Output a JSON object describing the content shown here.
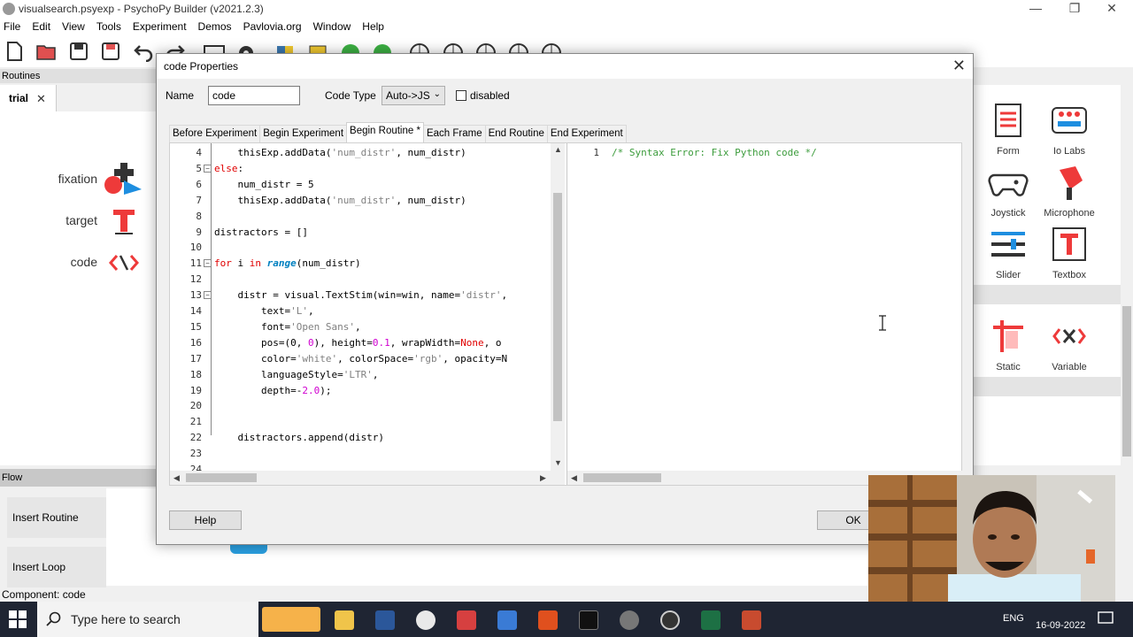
{
  "window": {
    "title": "visualsearch.psyexp - PsychoPy Builder (v2021.2.3)",
    "menu": [
      "File",
      "Edit",
      "View",
      "Tools",
      "Experiment",
      "Demos",
      "Pavlovia.org",
      "Window",
      "Help"
    ]
  },
  "routines": {
    "header": "Routines",
    "active_tab": "trial",
    "components": [
      "fixation",
      "target",
      "code"
    ]
  },
  "flow": {
    "header": "Flow",
    "insert_routine": "Insert Routine",
    "insert_loop": "Insert Loop"
  },
  "status_bar": "Component: code",
  "components_panel": {
    "items": [
      {
        "label": "Form",
        "icon": "form-icon"
      },
      {
        "label": "Io Labs",
        "icon": "iolabs-icon"
      },
      {
        "label": "Joystick",
        "icon": "joystick-icon"
      },
      {
        "label": "Microphone",
        "icon": "microphone-icon"
      },
      {
        "label": "Slider",
        "icon": "slider-icon"
      },
      {
        "label": "Textbox",
        "icon": "textbox-icon"
      },
      {
        "label": "Static",
        "icon": "static-icon"
      },
      {
        "label": "Variable",
        "icon": "variable-icon"
      }
    ]
  },
  "dialog": {
    "title": "code Properties",
    "name_label": "Name",
    "name_value": "code",
    "code_type_label": "Code Type",
    "code_type_value": "Auto->JS",
    "disabled_label": "disabled",
    "tabs": [
      "Before Experiment",
      "Begin Experiment",
      "Begin Routine *",
      "Each Frame",
      "End Routine",
      "End Experiment"
    ],
    "active_tab_index": 2,
    "python_code": [
      {
        "n": "4",
        "text": "    thisExp.addData('num_distr', num_distr)"
      },
      {
        "n": "5",
        "text": "else:"
      },
      {
        "n": "6",
        "text": "    num_distr = 5"
      },
      {
        "n": "7",
        "text": "    thisExp.addData('num_distr', num_distr)"
      },
      {
        "n": "8",
        "text": ""
      },
      {
        "n": "9",
        "text": "distractors = []"
      },
      {
        "n": "10",
        "text": ""
      },
      {
        "n": "11",
        "text": "for i in range(num_distr)"
      },
      {
        "n": "12",
        "text": ""
      },
      {
        "n": "13",
        "text": "    distr = visual.TextStim(win=win, name='distr',"
      },
      {
        "n": "14",
        "text": "        text='L',"
      },
      {
        "n": "15",
        "text": "        font='Open Sans',"
      },
      {
        "n": "16",
        "text": "        pos=(0, 0), height=0.1, wrapWidth=None, o"
      },
      {
        "n": "17",
        "text": "        color='white', colorSpace='rgb', opacity=N"
      },
      {
        "n": "18",
        "text": "        languageStyle='LTR',"
      },
      {
        "n": "19",
        "text": "        depth=-2.0);"
      },
      {
        "n": "20",
        "text": ""
      },
      {
        "n": "21",
        "text": ""
      },
      {
        "n": "22",
        "text": "    distractors.append(distr)"
      },
      {
        "n": "23",
        "text": ""
      },
      {
        "n": "24",
        "text": ""
      }
    ],
    "js_code": [
      {
        "n": "1",
        "text": "/* Syntax Error: Fix Python code */"
      }
    ],
    "help_label": "Help",
    "ok_label": "OK"
  },
  "taskbar": {
    "search_placeholder": "Type here to search",
    "language": "ENG",
    "date": "16-09-2022"
  },
  "colors": {
    "keyword": "#e00000",
    "builtin": "#0080c0",
    "number": "#d000d0",
    "string": "#808080",
    "comment": "#3c9c3c",
    "taskbar": "#1f2533"
  }
}
